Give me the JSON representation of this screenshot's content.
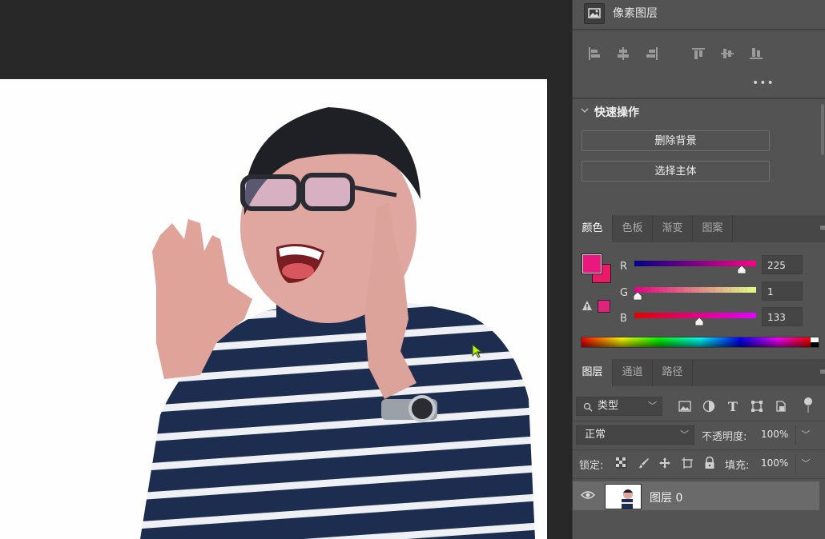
{
  "properties": {
    "title": "像素图层"
  },
  "quick_actions": {
    "title": "快速操作",
    "remove_bg": "删除背景",
    "select_subject": "选择主体"
  },
  "color_panel": {
    "tabs": [
      "颜色",
      "色板",
      "渐变",
      "图案"
    ],
    "foreground": "#e8187e",
    "background": "#ea1a69",
    "channels": [
      {
        "label": "R",
        "value": "225"
      },
      {
        "label": "G",
        "value": "1"
      },
      {
        "label": "B",
        "value": "133"
      }
    ]
  },
  "layers_panel": {
    "tabs": [
      "图层",
      "通道",
      "路径"
    ],
    "filter_label": "类型",
    "blend_mode": "正常",
    "opacity_label": "不透明度:",
    "opacity_value": "100%",
    "lock_label": "锁定:",
    "fill_label": "填充:",
    "fill_value": "100%",
    "layer_name": "图层 0"
  }
}
